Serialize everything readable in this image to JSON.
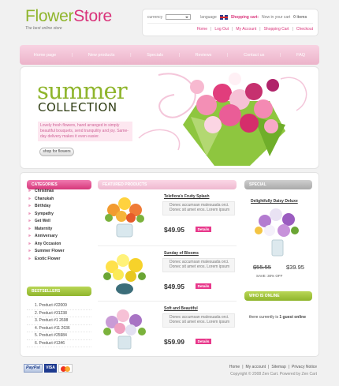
{
  "header": {
    "logo_part1": "Flower",
    "logo_part2": "Store",
    "tagline": "The best online store",
    "currency_label": "currency",
    "language_label": "language",
    "cart_label": "Shopping cart:",
    "cart_status": "Now in your cart",
    "cart_items": "0 items",
    "links": [
      "Home",
      "Log Out",
      "My Account",
      "Shopping Cart",
      "Checkout"
    ]
  },
  "nav": [
    "Home page",
    "New products",
    "Specials",
    "Reviews",
    "Contact us",
    "FAQ"
  ],
  "banner": {
    "title": "summer",
    "subtitle": "COLLECTION",
    "text": "Lovely fresh flowers, hand arranged in simply beautiful bouquets, send tranquility and joy. Same-day delivery makes it even easier.",
    "button": "shop for flowers"
  },
  "categories": {
    "title": "CATEGORIES",
    "items": [
      "Christmas",
      "Chanukah",
      "Birthday",
      "Sympathy",
      "Get Well",
      "Maternity",
      "Anniversary",
      "Any Occasion",
      "Summer Flower",
      "Exotic Flower"
    ]
  },
  "bestsellers": {
    "title": "BESTSELLERS",
    "items": [
      "1. Product #22009",
      "2. Product #31238",
      "3. Product #1 2698",
      "4. Product #11 2636",
      "5. Product #25984",
      "6. Product #1346"
    ]
  },
  "featured": {
    "title": "FEATURED PRODUCTS",
    "products": [
      {
        "name": "Telefiora's Fruity Splash",
        "desc": "Donec accumsan malesuada orci. Donec sit amet eros. Lorem ipsum",
        "price": "$49.95",
        "details": "Details"
      },
      {
        "name": "Sunday of Blooms",
        "desc": "Donec accumsan malesuada orci. Donec sit amet eros. Lorem ipsum",
        "price": "$49.95",
        "details": "Details"
      },
      {
        "name": "Soft and Beautiful",
        "desc": "Donec accumsan malesuada orci. Donec sit amet eros. Lorem ipsum",
        "price": "$59.99",
        "details": "Details"
      }
    ]
  },
  "special": {
    "title": "SPECIAL",
    "product": "Delightfully Daisy Deluxe",
    "old_price": "$55.55",
    "new_price": "$39.95",
    "save": "SAVE: 30% OFF"
  },
  "who_online": {
    "title": "WHO IS ONLINE",
    "prefix": "there currently is",
    "count": "1 guest online"
  },
  "footer": {
    "links": [
      "Home",
      "My account",
      "Sitemap",
      "Privacy Notice"
    ],
    "copyright": "Copyright © 2008 Zen Cart. Powered by Zen Cart",
    "paypal": "PayPal",
    "visa": "VISA"
  }
}
